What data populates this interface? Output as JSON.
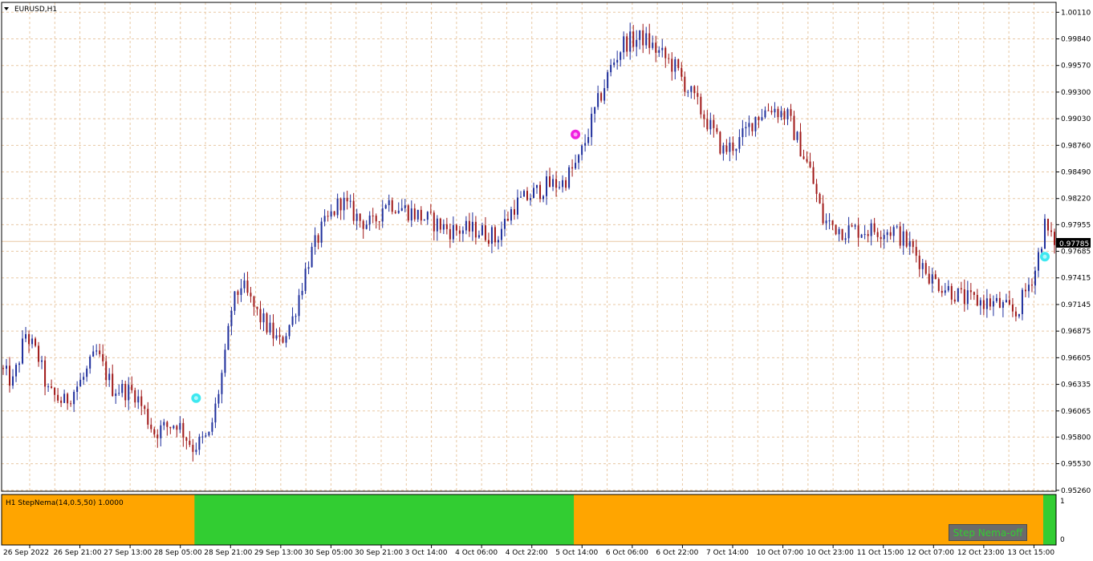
{
  "symbol_label": "EURUSD,H1",
  "indicator_label": "H1 StepNema(14,0.5,50) 1.0000",
  "indicator_scale": [
    "1",
    "0"
  ],
  "toggle_button": "Step Nema-off",
  "current_price": "0.97785",
  "colors": {
    "grid": "#e8c8a4",
    "bull": "#1f2f9c",
    "bear": "#a01818",
    "orange": "#ffa500",
    "green": "#32cd32",
    "buy_marker": "#3de8f0",
    "sell_marker": "#f020e0",
    "price_line": "#e8c8a4"
  },
  "chart_data": {
    "type": "candlestick",
    "title": "EURUSD,H1",
    "y_range": [
      0.9525,
      1.0021
    ],
    "y_ticks": [
      "1.00110",
      "0.99840",
      "0.99570",
      "0.99300",
      "0.99030",
      "0.98760",
      "0.98490",
      "0.98220",
      "0.97955",
      "0.97685",
      "0.97415",
      "0.97145",
      "0.96875",
      "0.96605",
      "0.96335",
      "0.96065",
      "0.95800",
      "0.95530",
      "0.95260"
    ],
    "x_ticks": [
      "26 Sep 2022",
      "26 Sep 21:00",
      "27 Sep 13:00",
      "28 Sep 05:00",
      "28 Sep 21:00",
      "29 Sep 13:00",
      "30 Sep 05:00",
      "30 Sep 21:00",
      "3 Oct 14:00",
      "4 Oct 06:00",
      "4 Oct 22:00",
      "5 Oct 14:00",
      "6 Oct 06:00",
      "6 Oct 22:00",
      "7 Oct 14:00",
      "10 Oct 07:00",
      "10 Oct 23:00",
      "11 Oct 15:00",
      "12 Oct 07:00",
      "12 Oct 23:00",
      "13 Oct 15:00"
    ],
    "grid": true,
    "bar_count": 328,
    "path_anchors": [
      [
        0,
        0.965
      ],
      [
        4,
        0.9635
      ],
      [
        8,
        0.9685
      ],
      [
        12,
        0.966
      ],
      [
        15,
        0.9625
      ],
      [
        20,
        0.9615
      ],
      [
        26,
        0.964
      ],
      [
        30,
        0.9665
      ],
      [
        35,
        0.963
      ],
      [
        42,
        0.9625
      ],
      [
        48,
        0.9585
      ],
      [
        55,
        0.9595
      ],
      [
        60,
        0.957
      ],
      [
        65,
        0.958
      ],
      [
        67,
        0.961
      ],
      [
        70,
        0.966
      ],
      [
        72,
        0.971
      ],
      [
        75,
        0.9735
      ],
      [
        80,
        0.9705
      ],
      [
        87,
        0.9675
      ],
      [
        91,
        0.97
      ],
      [
        96,
        0.976
      ],
      [
        100,
        0.979
      ],
      [
        106,
        0.982
      ],
      [
        112,
        0.98
      ],
      [
        116,
        0.9795
      ],
      [
        120,
        0.982
      ],
      [
        130,
        0.9805
      ],
      [
        140,
        0.979
      ],
      [
        148,
        0.979
      ],
      [
        153,
        0.9785
      ],
      [
        160,
        0.9815
      ],
      [
        170,
        0.9835
      ],
      [
        175,
        0.9838
      ],
      [
        180,
        0.986
      ],
      [
        185,
        0.991
      ],
      [
        190,
        0.9955
      ],
      [
        154,
        0.978
      ],
      [
        194,
        0.998
      ],
      [
        200,
        0.9985
      ],
      [
        210,
        0.9955
      ],
      [
        220,
        0.99
      ],
      [
        225,
        0.987
      ],
      [
        230,
        0.988
      ],
      [
        235,
        0.9905
      ],
      [
        240,
        0.9915
      ],
      [
        245,
        0.9905
      ],
      [
        252,
        0.985
      ],
      [
        256,
        0.98
      ],
      [
        262,
        0.979
      ],
      [
        270,
        0.979
      ],
      [
        278,
        0.979
      ],
      [
        284,
        0.977
      ],
      [
        290,
        0.974
      ],
      [
        300,
        0.972
      ],
      [
        310,
        0.9715
      ],
      [
        316,
        0.9705
      ],
      [
        322,
        0.975
      ],
      [
        325,
        0.9795
      ],
      [
        327,
        0.978
      ]
    ],
    "markers": [
      {
        "type": "buy",
        "bar": 60,
        "price": 0.96195
      },
      {
        "type": "sell",
        "bar": 178,
        "price": 0.9887
      },
      {
        "type": "buy",
        "bar": 324,
        "price": 0.9763
      }
    ],
    "indicator_segments": [
      {
        "from_bar": 0,
        "to_bar": 60,
        "state": "orange"
      },
      {
        "from_bar": 60,
        "to_bar": 178,
        "state": "green"
      },
      {
        "from_bar": 178,
        "to_bar": 324,
        "state": "orange"
      },
      {
        "from_bar": 324,
        "to_bar": 327,
        "state": "green"
      }
    ]
  }
}
